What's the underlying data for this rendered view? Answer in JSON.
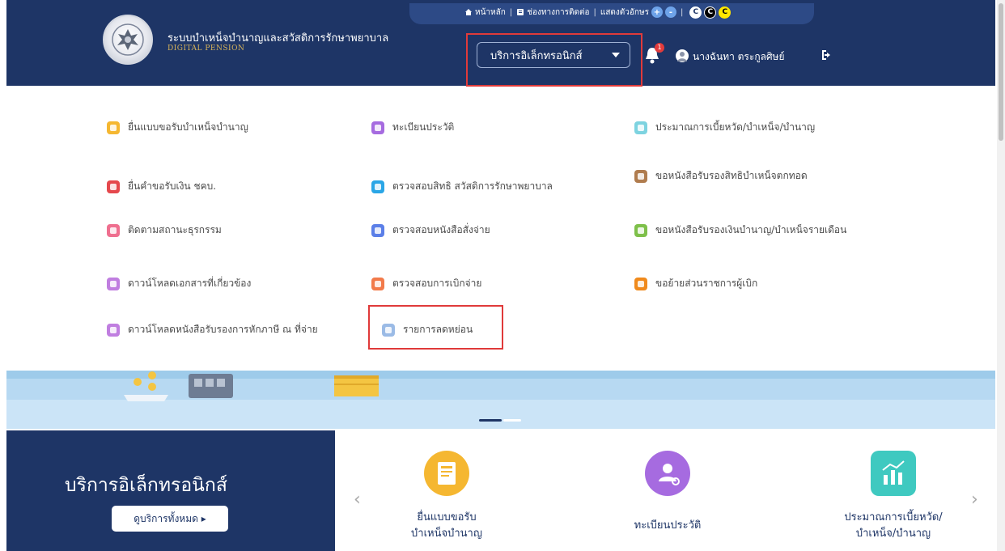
{
  "header": {
    "site_title": "ระบบบำเหน็จบำนาญและสวัสดิการรักษาพยาบาล",
    "site_subtitle": "DIGITAL PENSION",
    "topbar": {
      "home": "หน้าหลัก",
      "contact": "ช่องทางการติดต่อ",
      "display": "แสดงตัวอักษร",
      "zoom_in": "+",
      "zoom_out": "-",
      "contrast_1": "C",
      "contrast_2": "C",
      "contrast_3": "C"
    },
    "service_dropdown": "บริการอิเล็กทรอนิกส์",
    "notification_count": "1",
    "user_name": "นางฉันทา ตระกูลศิษย์"
  },
  "menu": {
    "col1": [
      {
        "label": "ยื่นแบบขอรับบำเหน็จบำนาญ",
        "color": "#f5b731"
      },
      {
        "label": "ยื่นคำขอรับเงิน ชคบ.",
        "color": "#e5484d"
      },
      {
        "label": "ติดตามสถานะธุรกรรม",
        "color": "#ef6f8f"
      },
      {
        "label": "ดาวน์โหลดเอกสารที่เกี่ยวข้อง",
        "color": "#c07ee0"
      },
      {
        "label": "ดาวน์โหลดหนังสือรับรองการหักภาษี ณ ที่จ่าย",
        "color": "#c07ee0"
      }
    ],
    "col2": [
      {
        "label": "ทะเบียนประวัติ",
        "color": "#a66be0"
      },
      {
        "label": "ตรวจสอบสิทธิ สวัสดิการรักษาพยาบาล",
        "color": "#2aa6e6"
      },
      {
        "label": "ตรวจสอบหนังสือสั่งจ่าย",
        "color": "#5b7fe8"
      },
      {
        "label": "ตรวจสอบการเบิกจ่าย",
        "color": "#f27a4a"
      },
      {
        "label": "รายการลดหย่อน",
        "color": "#9bbbe6"
      }
    ],
    "col3": [
      {
        "label": "ประมาณการเบี้ยหวัด/บำเหน็จ/บำนาญ",
        "color": "#7dd3e0"
      },
      {
        "label": "ขอหนังสือรับรองสิทธิบำเหน็จตกทอด",
        "color": "#b07c4e"
      },
      {
        "label": "ขอหนังสือรับรองเงินบำนาญ/บำเหน็จรายเดือน",
        "color": "#7ec04a"
      },
      {
        "label": "ขอย้ายส่วนราชการผู้เบิก",
        "color": "#f08a1c"
      }
    ]
  },
  "services": {
    "title": "บริการอิเล็กทรอนิกส์",
    "all_button": "ดูบริการทั้งหมด ▸",
    "prev": "‹",
    "next": "›",
    "cards": [
      {
        "line1": "ยื่นแบบขอรับ",
        "line2": "บำเหน็จบำนาญ",
        "color": "#f5b731"
      },
      {
        "line1": "ทะเบียนประวัติ",
        "line2": "",
        "color": "#a66be0"
      },
      {
        "line1": "ประมาณการเบี้ยหวัด/",
        "line2": "บำเหน็จ/บำนาญ",
        "color": "#3fc9c0"
      }
    ]
  }
}
